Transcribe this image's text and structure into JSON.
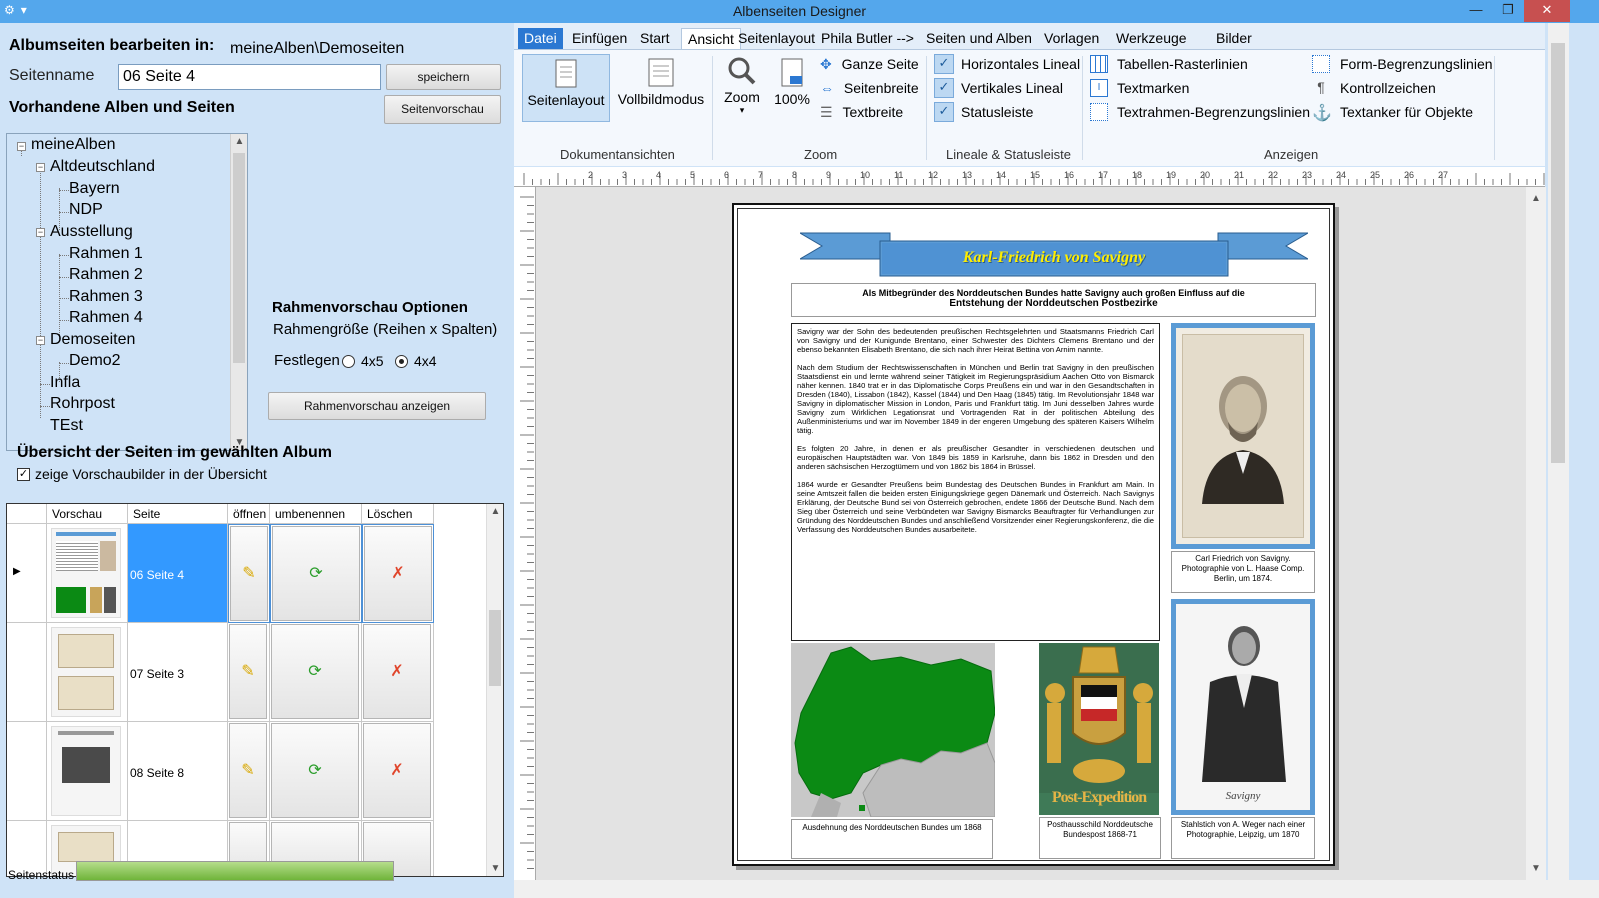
{
  "window": {
    "title": "Albenseiten Designer",
    "minimize": "—",
    "maximize": "❐",
    "close": "✕"
  },
  "left": {
    "edit_label": "Albumseiten bearbeiten in:",
    "edit_path": "meineAlben\\Demoseiten",
    "pagename_label": "Seitenname",
    "pagename_value": "06 Seite 4",
    "save_button": "speichern",
    "preview_button": "Seitenvorschau",
    "existing_label": "Vorhandene Alben und Seiten",
    "tree": [
      {
        "label": "meineAlben",
        "level": 0,
        "box": "−"
      },
      {
        "label": "Altdeutschland",
        "level": 1,
        "box": "−"
      },
      {
        "label": "Bayern",
        "level": 2
      },
      {
        "label": "NDP",
        "level": 2
      },
      {
        "label": "Ausstellung",
        "level": 1,
        "box": "−"
      },
      {
        "label": "Rahmen 1",
        "level": 2
      },
      {
        "label": "Rahmen 2",
        "level": 2
      },
      {
        "label": "Rahmen 3",
        "level": 2
      },
      {
        "label": "Rahmen 4",
        "level": 2
      },
      {
        "label": "Demoseiten",
        "level": 1,
        "box": "−"
      },
      {
        "label": "Demo2",
        "level": 2
      },
      {
        "label": "Infla",
        "level": 1
      },
      {
        "label": "Rohrpost",
        "level": 1
      },
      {
        "label": "TEst",
        "level": 1
      }
    ],
    "frame_options_title": "Rahmenvorschau Optionen",
    "frame_size_label": "Rahmengröße (Reihen x Spalten)",
    "fix_label": "Festlegen",
    "radio_4x5": "4x5",
    "radio_4x4": "4x4",
    "frame_preview_button": "Rahmenvorschau anzeigen",
    "overview_title": "Übersicht der Seiten im gewählten Album",
    "show_thumbs_label": "zeige Vorschaubilder in der Übersicht",
    "grid_headers": [
      "Vorschau",
      "Seite",
      "öffnen",
      "umbenennen",
      "Löschen"
    ],
    "grid_rows": [
      {
        "page": "06 Seite 4",
        "selected": true
      },
      {
        "page": "07 Seite 3",
        "selected": false
      },
      {
        "page": "08 Seite 8",
        "selected": false
      },
      {
        "page": "",
        "selected": false
      }
    ],
    "status_label": "Seitenstatus"
  },
  "ribbon": {
    "tabs": [
      "Datei",
      "Einfügen",
      "Start",
      "Ansicht",
      "Seitenlayout",
      "Phila Butler -->",
      "Seiten und Alben",
      "Vorlagen",
      "Werkzeuge",
      "Bilder"
    ],
    "active_tab": "Ansicht",
    "big_buttons": [
      "Seitenlayout",
      "Vollbildmodus",
      "Zoom",
      "100%"
    ],
    "zoom_items": [
      "Ganze Seite",
      "Seitenbreite",
      "Textbreite"
    ],
    "ruler_items": [
      "Horizontales Lineal",
      "Vertikales Lineal",
      "Statusleiste"
    ],
    "show_items_1": [
      "Tabellen-Rasterlinien",
      "Textmarken",
      "Textrahmen-Begrenzungslinien"
    ],
    "show_items_2": [
      "Form-Begrenzungslinien",
      "Kontrollzeichen",
      "Textanker für Objekte"
    ],
    "groups": [
      "Dokumentansichten",
      "Zoom",
      "Lineale & Statusleiste",
      "Anzeigen"
    ]
  },
  "ruler": {
    "ticks": [
      "2",
      "3",
      "4",
      "5",
      "6",
      "7",
      "8",
      "9",
      "10",
      "11",
      "12",
      "13",
      "14",
      "15",
      "16",
      "17",
      "18",
      "19",
      "20",
      "21",
      "22",
      "23",
      "24",
      "25",
      "26",
      "27"
    ]
  },
  "page": {
    "banner_title": "Karl-Friedrich von Savigny",
    "subtitle_line1": "Als Mitbegründer des Norddeutschen Bundes hatte Savigny auch großen Einfluss auf die",
    "subtitle_line2": "Entstehung der Norddeutschen Postbezirke",
    "para1": "Savigny war der Sohn des bedeutenden preußischen Rechtsgelehrten und Staatsmanns Friedrich Carl von Savigny und der Kunigunde Brentano, einer Schwester des Dichters Clemens Brentano und der ebenso bekannten Elisabeth Brentano, die sich nach ihrer Heirat Bettina von Arnim nannte.",
    "para2": "Nach dem Studium der Rechtswissenschaften in München und Berlin trat Savigny in den preußischen Staatsdienst ein und lernte während seiner Tätigkeit im Regierungspräsidium Aachen Otto von Bismarck näher kennen. 1840 trat er in das Diplomatische Corps Preußens ein und war in den Gesandtschaften in Dresden (1840), Lissabon (1842), Kassel (1844) und Den Haag (1845) tätig. Im Revolutionsjahr 1848 war Savigny in diplomatischer Mission in London, Paris und Frankfurt tätig. Im Juni desselben Jahres wurde Savigny zum Wirklichen Legationsrat und Vortragenden Rat in der politischen Abteilung des Außenministeriums und war im November 1849 in der engeren Umgebung des späteren Kaisers Wilhelm tätig.",
    "para3": "Es folgten 20 Jahre, in denen er als preußischer Gesandter in verschiedenen deutschen und europäischen Hauptstädten war. Von 1849 bis 1859 in Karlsruhe, dann bis 1862 in Dresden und den anderen sächsischen Herzogtümern und von 1862 bis 1864 in Brüssel.",
    "para4": "1864 wurde er Gesandter Preußens beim Bundestag des Deutschen Bundes in Frankfurt am Main. In seine Amtszeit fallen die beiden ersten Einigungskriege gegen Dänemark und Österreich. Nach Savignys Erklärung, der Deutsche Bund sei von Österreich gebrochen, endete 1866 der Deutsche Bund. Nach dem Sieg über Österreich und seine Verbündeten war Savigny Bismarcks Beauftragter für Verhandlungen zur Gründung des Norddeutschen Bundes und anschließend Vorsitzender einer Regierungskonferenz, die die Verfassung des Norddeutschen Bundes ausarbeitete.",
    "caption_portrait1": "Carl Friedrich von Savigny. Photographie von L. Haase Comp. Berlin, um 1874.",
    "caption_map": "Ausdehnung des Norddeutschen Bundes um 1868",
    "caption_sign": "Posthausschild Norddeutsche Bundespost 1868-71",
    "caption_portrait2": "Stahlstich von A. Weger nach einer Photographie, Leipzig, um 1870",
    "sign_text": "Post-Expedition",
    "portrait2_signature": "Savigny"
  },
  "colors": {
    "titlebar": "#54a7ec",
    "panel": "#cfe3f7",
    "selection": "#3399ff",
    "banner": "#5b9bd5",
    "banner_text": "#ffee00",
    "map_green": "#0b8a14"
  }
}
